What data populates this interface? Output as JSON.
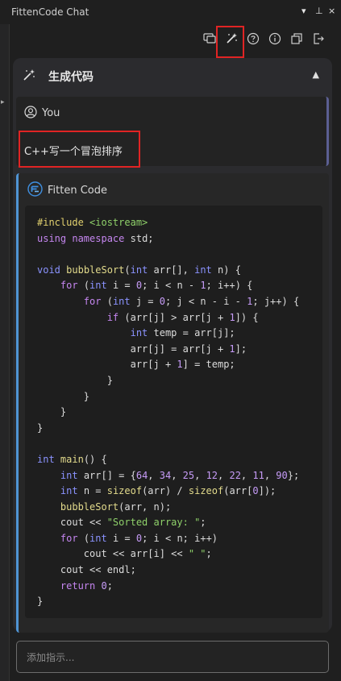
{
  "window": {
    "title": "FittenCode Chat",
    "controls": [
      "▾",
      "⊥",
      "×"
    ]
  },
  "toolbar": {
    "icons": [
      "chat-bubble-icon",
      "magic-wand-icon",
      "help-icon",
      "info-icon",
      "copy-window-icon",
      "logout-icon"
    ],
    "highlighted": "magic-wand-icon"
  },
  "panel": {
    "title": "生成代码",
    "collapse_glyph": "▲"
  },
  "user_message": {
    "author": "You",
    "text": "C++写一个冒泡排序"
  },
  "assistant_message": {
    "author": "Fitten Code"
  },
  "code": {
    "lines": [
      "#include <iostream>",
      "using namespace std;",
      "",
      "void bubbleSort(int arr[], int n) {",
      "    for (int i = 0; i < n - 1; i++) {",
      "        for (int j = 0; j < n - i - 1; j++) {",
      "            if (arr[j] > arr[j + 1]) {",
      "                int temp = arr[j];",
      "                arr[j] = arr[j + 1];",
      "                arr[j + 1] = temp;",
      "            }",
      "        }",
      "    }",
      "}",
      "",
      "int main() {",
      "    int arr[] = {64, 34, 25, 12, 22, 11, 90};",
      "    int n = sizeof(arr) / sizeof(arr[0]);",
      "    bubbleSort(arr, n);",
      "    cout << \"Sorted array: \";",
      "    for (int i = 0; i < n; i++)",
      "        cout << arr[i] << \" \";",
      "    cout << endl;",
      "    return 0;",
      "}"
    ]
  },
  "input": {
    "placeholder": "添加指示..."
  },
  "colors": {
    "background": "#1f1f1f",
    "panel": "#2b2b2e",
    "highlight": "#e02424",
    "user_accent": "#5b5f92",
    "assistant_accent": "#4f94d4"
  }
}
